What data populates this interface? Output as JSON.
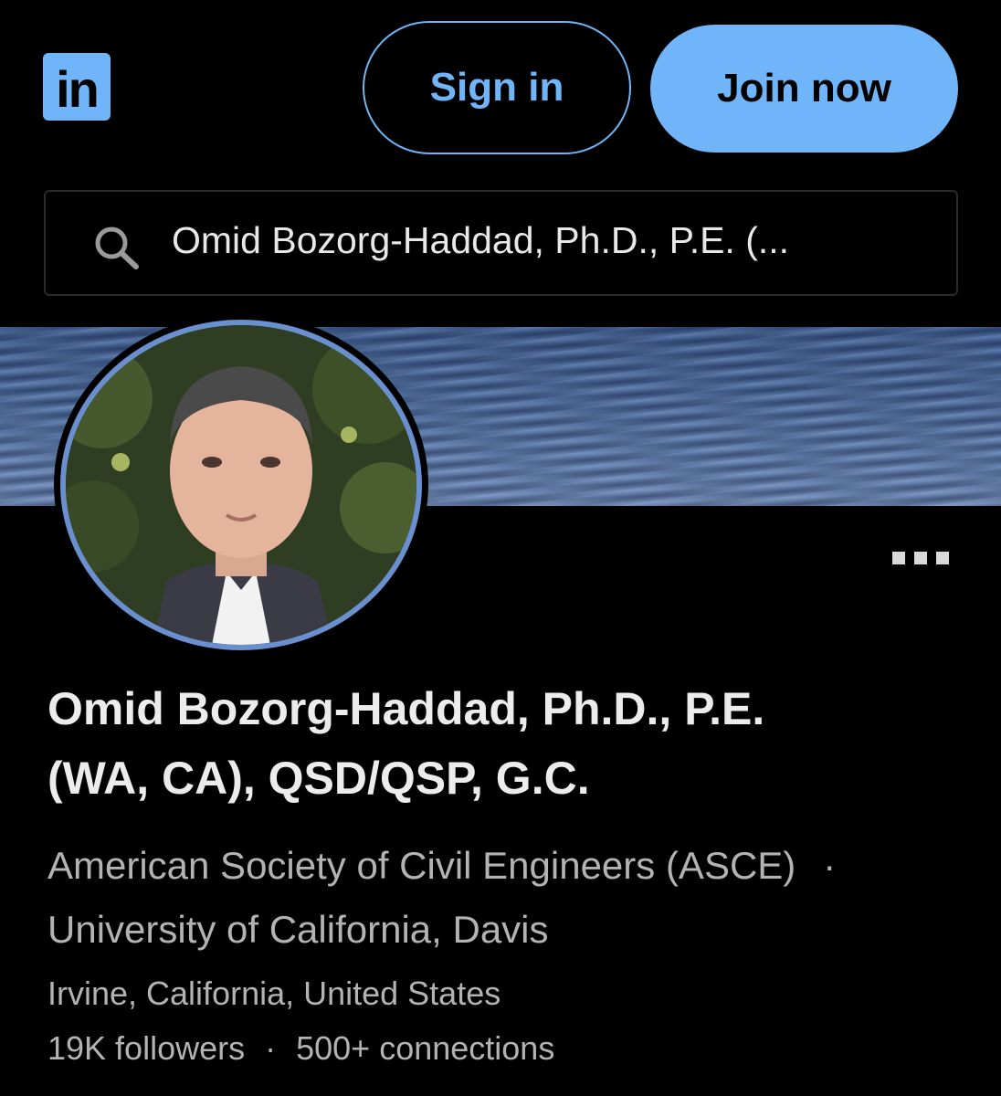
{
  "header": {
    "logo_text": "in",
    "signin_label": "Sign in",
    "join_label": "Join now"
  },
  "search": {
    "value": "Omid Bozorg-Haddad, Ph.D., P.E. (..."
  },
  "profile": {
    "name_line1": "Omid Bozorg-Haddad, Ph.D., P.E.",
    "name_line2": "(WA, CA), QSD/QSP, G.C.",
    "headline_org": "American Society of Civil Engineers (ASCE)",
    "headline_separator": "·",
    "headline_school": "University of California, Davis",
    "location": "Irvine, California, United States",
    "followers": "19K followers",
    "stats_separator": "·",
    "connections": "500+ connections"
  },
  "icons": {
    "search": "search-icon",
    "more": "more-icon"
  },
  "colors": {
    "accent": "#70b5f9",
    "background": "#000000",
    "primary_text": "#ececec",
    "secondary_text": "#b3b3b3"
  }
}
